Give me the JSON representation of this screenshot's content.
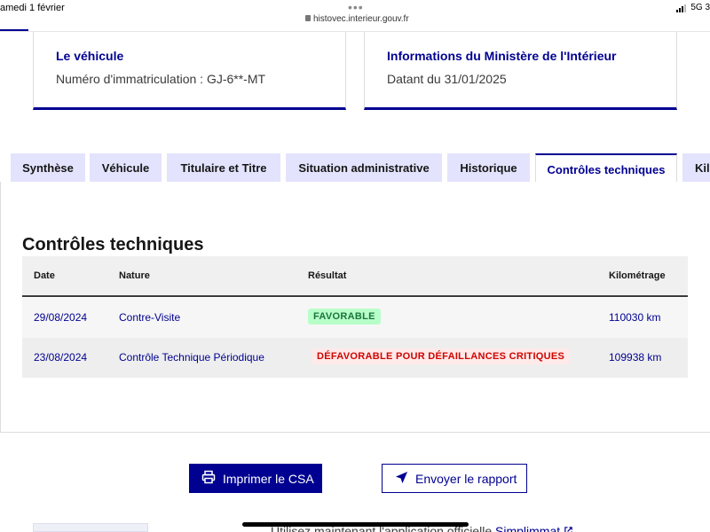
{
  "status_bar": {
    "time_date": "amedi 1 février",
    "url": "histovec.interieur.gouv.fr",
    "network": "5G",
    "battery_fragment": "3"
  },
  "cards": [
    {
      "title": "Le véhicule",
      "text": "Numéro d'immatriculation : GJ-6**-MT"
    },
    {
      "title": "Informations du Ministère de l'Intérieur",
      "text": "Datant du 31/01/2025"
    }
  ],
  "tabs": [
    {
      "label": "Synthèse",
      "active": false
    },
    {
      "label": "Véhicule",
      "active": false
    },
    {
      "label": "Titulaire et Titre",
      "active": false
    },
    {
      "label": "Situation administrative",
      "active": false
    },
    {
      "label": "Historique",
      "active": false
    },
    {
      "label": "Contrôles techniques",
      "active": true
    },
    {
      "label": "Kil",
      "active": false
    }
  ],
  "section": {
    "title": "Contrôles techniques",
    "columns": {
      "date": "Date",
      "nature": "Nature",
      "result": "Résultat",
      "mileage": "Kilométrage"
    },
    "rows": [
      {
        "date": "29/08/2024",
        "nature": "Contre-Visite",
        "result": "FAVORABLE",
        "result_status": "success",
        "mileage": "110030 km"
      },
      {
        "date": "23/08/2024",
        "nature": "Contrôle Technique Périodique",
        "result": "DÉFAVORABLE POUR DÉFAILLANCES CRITIQUES",
        "result_status": "error",
        "mileage": "109938 km"
      }
    ]
  },
  "actions": {
    "print_label": "Imprimer le CSA",
    "send_label": "Envoyer le rapport"
  },
  "footer": {
    "text": "Utilisez maintenant l'application officielle",
    "link": "Simplimmat"
  },
  "colors": {
    "primary": "#000091",
    "tab_bg": "#e3e3fd",
    "success_bg": "#b8fec9",
    "success_text": "#18753c",
    "error_bg": "#ffe9e9",
    "error_text": "#ce0500"
  },
  "icons": {
    "print": "printer-icon",
    "send": "paper-plane-icon",
    "external": "external-link-icon",
    "lock": "lock-icon"
  }
}
